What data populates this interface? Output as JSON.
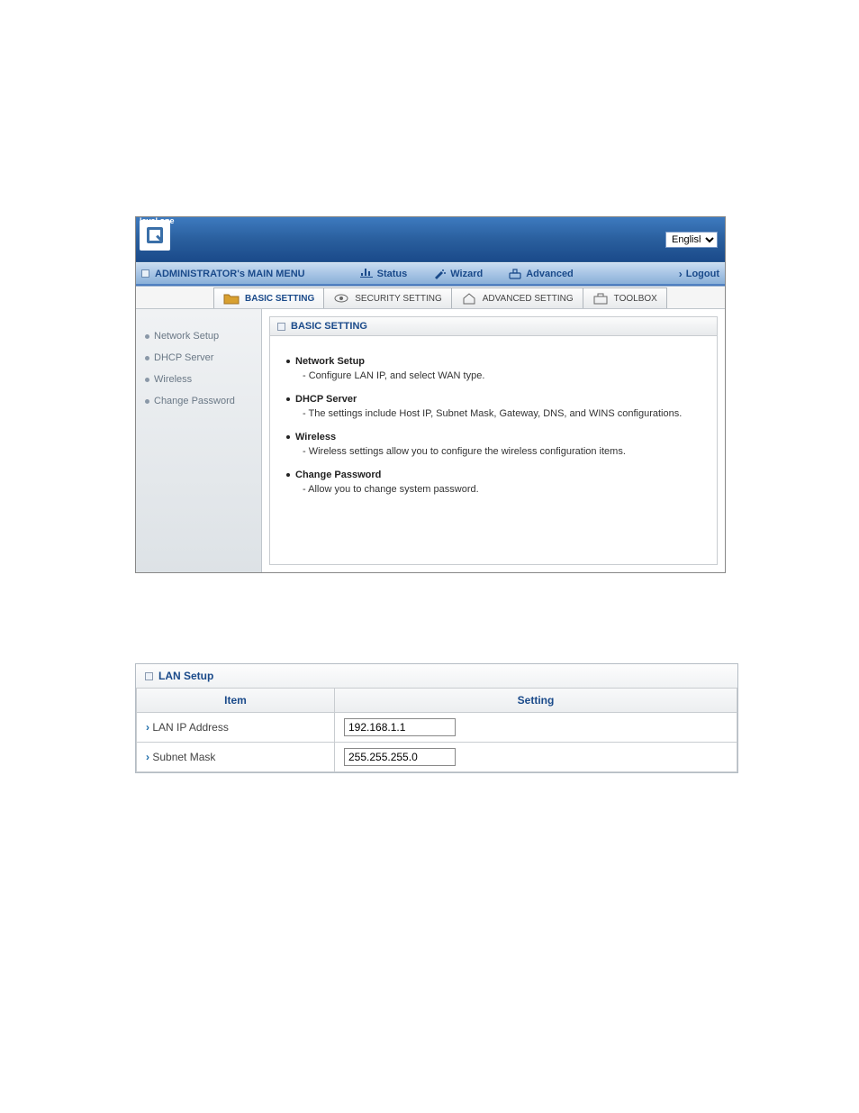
{
  "brand": "level one",
  "language": {
    "selected": "English"
  },
  "main_menu": {
    "title": "ADMINISTRATOR's MAIN MENU",
    "items": [
      {
        "label": "Status"
      },
      {
        "label": "Wizard"
      },
      {
        "label": "Advanced"
      }
    ],
    "logout": "Logout"
  },
  "tabs": [
    {
      "label": "BASIC SETTING",
      "active": true
    },
    {
      "label": "SECURITY SETTING",
      "active": false
    },
    {
      "label": "ADVANCED SETTING",
      "active": false
    },
    {
      "label": "TOOLBOX",
      "active": false
    }
  ],
  "sidebar": [
    {
      "label": "Network Setup"
    },
    {
      "label": "DHCP Server"
    },
    {
      "label": "Wireless"
    },
    {
      "label": "Change Password"
    }
  ],
  "panel": {
    "title": "BASIC SETTING",
    "sections": [
      {
        "title": "Network Setup",
        "desc": "Configure LAN IP, and select WAN type."
      },
      {
        "title": "DHCP Server",
        "desc": "The settings include Host IP, Subnet Mask, Gateway, DNS, and WINS configurations."
      },
      {
        "title": "Wireless",
        "desc": "Wireless settings allow you to configure the wireless configuration items."
      },
      {
        "title": "Change Password",
        "desc": "Allow you to change system password."
      }
    ]
  },
  "lan_setup": {
    "title": "LAN Setup",
    "columns": {
      "item": "Item",
      "setting": "Setting"
    },
    "rows": [
      {
        "label": "LAN IP Address",
        "value": "192.168.1.1"
      },
      {
        "label": "Subnet Mask",
        "value": "255.255.255.0"
      }
    ]
  }
}
